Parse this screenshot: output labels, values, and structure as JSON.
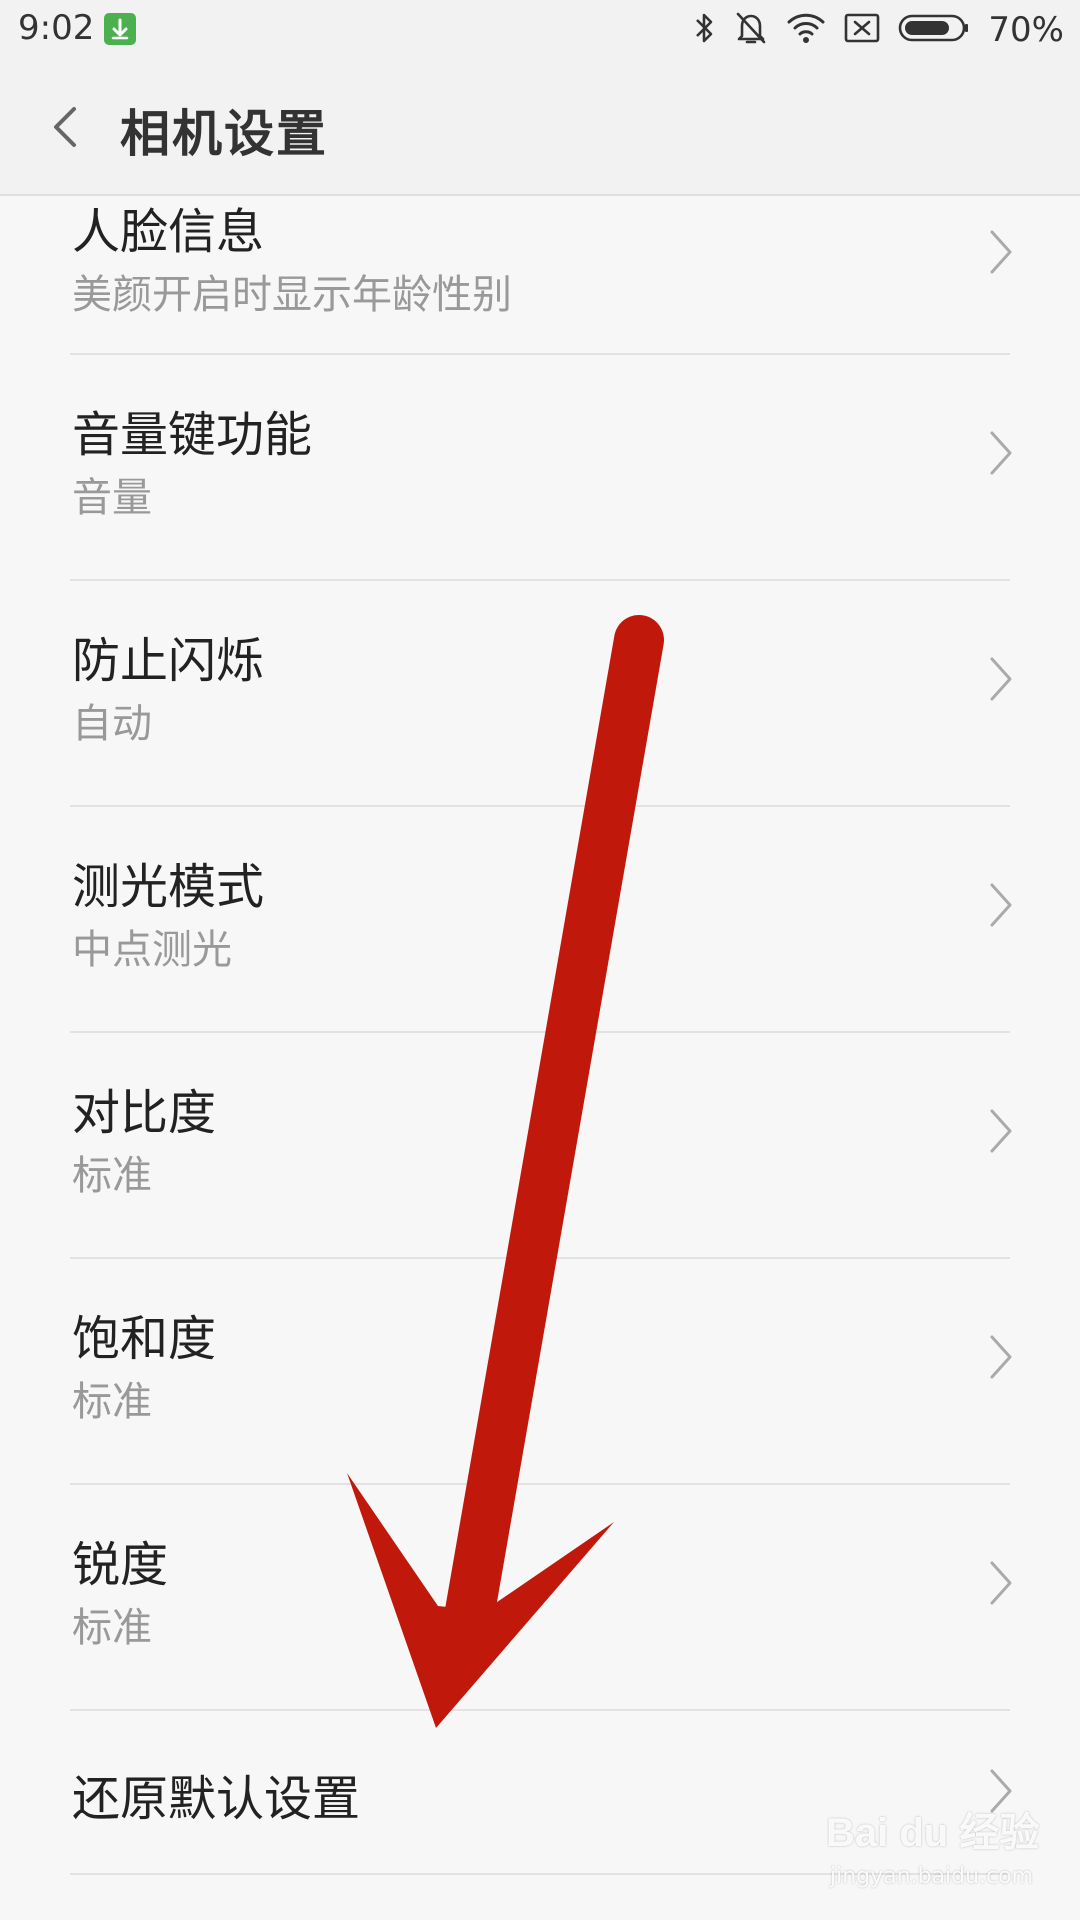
{
  "status_bar": {
    "time": "9:02",
    "battery": "70%",
    "icons": [
      "download-icon",
      "bluetooth-icon",
      "mute-bell-icon",
      "wifi-icon",
      "no-sim-icon",
      "battery-icon"
    ]
  },
  "header": {
    "title": "相机设置"
  },
  "settings": [
    {
      "title": "人脸信息",
      "subtitle": "美颜开启时显示年龄性别"
    },
    {
      "title": "音量键功能",
      "subtitle": "音量"
    },
    {
      "title": "防止闪烁",
      "subtitle": "自动"
    },
    {
      "title": "测光模式",
      "subtitle": "中点测光"
    },
    {
      "title": "对比度",
      "subtitle": "标准"
    },
    {
      "title": "饱和度",
      "subtitle": "标准"
    },
    {
      "title": "锐度",
      "subtitle": "标准"
    },
    {
      "title": "还原默认设置",
      "subtitle": ""
    }
  ],
  "colors": {
    "annotation_arrow": "#c0190c",
    "background": "#f7f7f7",
    "title_text": "#222222",
    "subtitle_text": "#999999"
  },
  "watermark": {
    "brand": "Bai du 经验",
    "url": "jingyan.baidu.com"
  }
}
